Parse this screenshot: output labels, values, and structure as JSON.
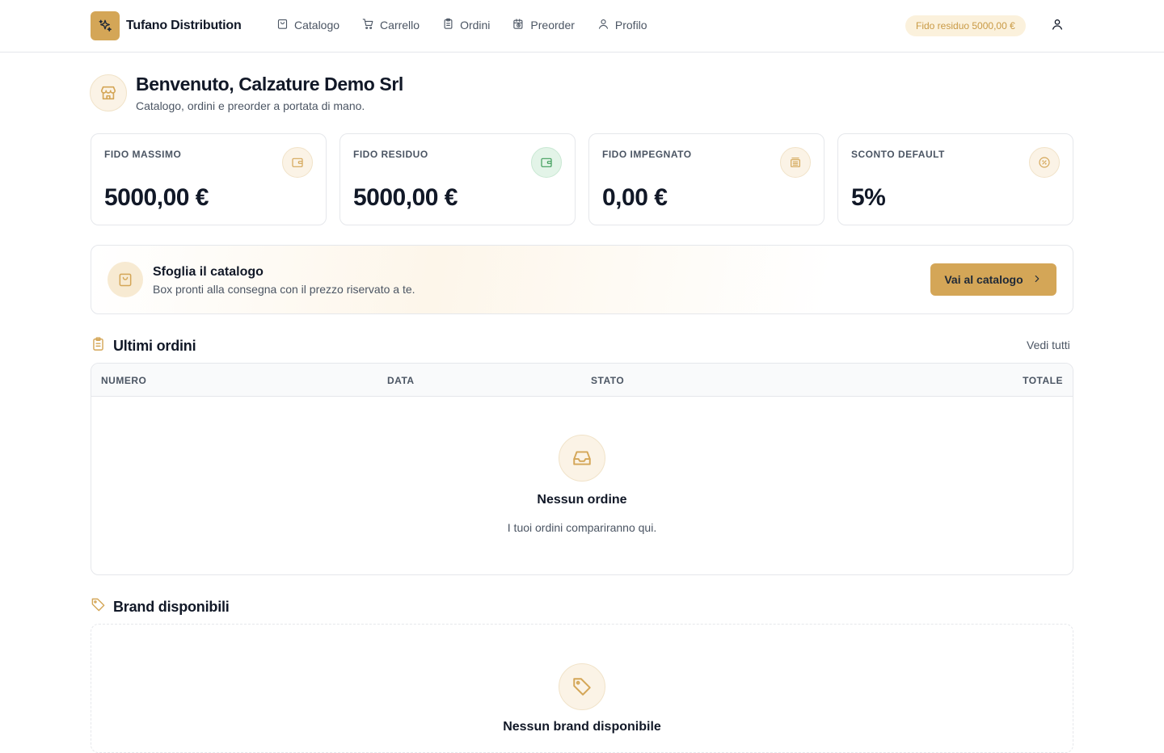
{
  "header": {
    "brand_name": "Tufano Distribution",
    "nav": [
      {
        "label": "Catalogo",
        "icon": "shopping-bag-icon"
      },
      {
        "label": "Carrello",
        "icon": "cart-icon"
      },
      {
        "label": "Ordini",
        "icon": "clipboard-icon"
      },
      {
        "label": "Preorder",
        "icon": "calendar-clock-icon"
      },
      {
        "label": "Profilo",
        "icon": "user-icon"
      }
    ],
    "fido_pill": "Fido residuo 5000,00 €"
  },
  "welcome": {
    "title": "Benvenuto, Calzature Demo Srl",
    "subtitle": "Catalogo, ordini e preorder a portata di mano."
  },
  "stats": [
    {
      "label": "FIDO MASSIMO",
      "value": "5000,00 €",
      "icon": "wallet-icon"
    },
    {
      "label": "FIDO RESIDUO",
      "value": "5000,00 €",
      "icon": "wallet-icon"
    },
    {
      "label": "FIDO IMPEGNATO",
      "value": "0,00 €",
      "icon": "stack-icon"
    },
    {
      "label": "SCONTO DEFAULT",
      "value": "5%",
      "icon": "discount-icon"
    }
  ],
  "catalog_banner": {
    "title": "Sfoglia il catalogo",
    "subtitle": "Box pronti alla consegna con il prezzo riservato a te.",
    "button_label": "Vai al catalogo"
  },
  "orders": {
    "title": "Ultimi ordini",
    "see_all": "Vedi tutti",
    "columns": [
      "NUMERO",
      "DATA",
      "STATO",
      "TOTALE"
    ],
    "empty_title": "Nessun ordine",
    "empty_subtitle": "I tuoi ordini compariranno qui."
  },
  "brands": {
    "title": "Brand disponibili",
    "empty_title": "Nessun brand disponibile"
  },
  "colors": {
    "accent": "#d4a657",
    "accent_soft": "#fbf3e6",
    "success_soft": "#e3f4e8",
    "success": "#3f9d5a"
  }
}
